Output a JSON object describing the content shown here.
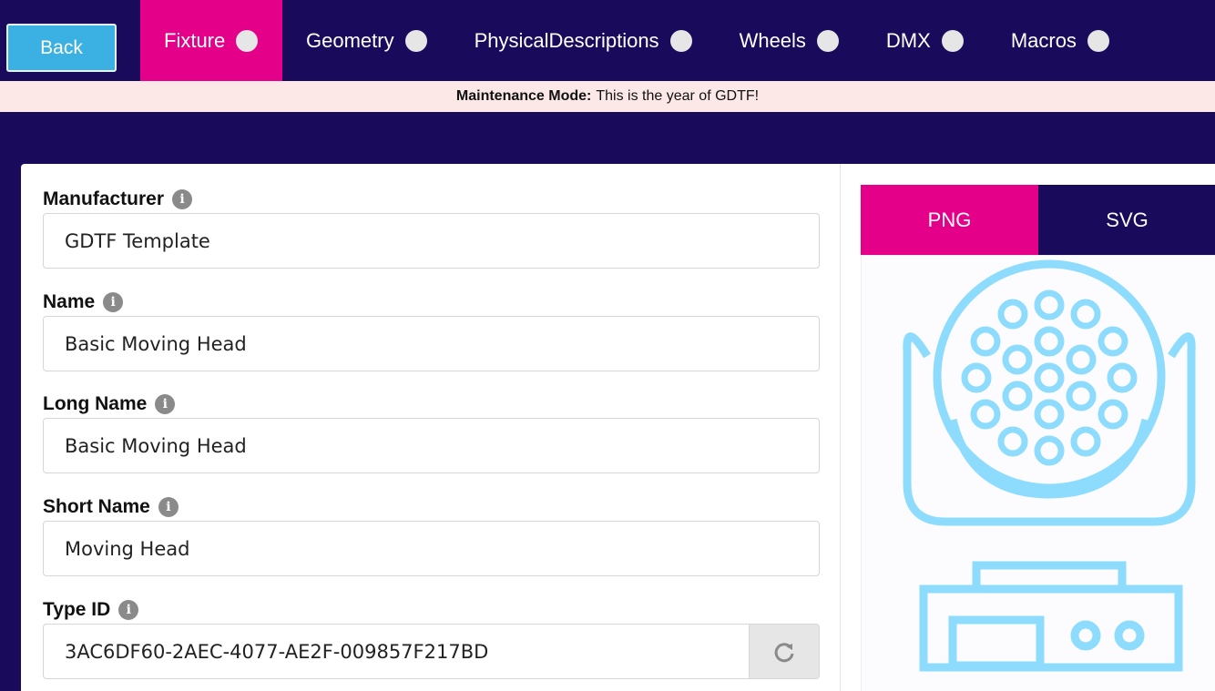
{
  "topbar": {
    "back_label": "Back",
    "tabs": [
      {
        "label": "Fixture",
        "active": true
      },
      {
        "label": "Geometry",
        "active": false
      },
      {
        "label": "PhysicalDescriptions",
        "active": false
      },
      {
        "label": "Wheels",
        "active": false
      },
      {
        "label": "DMX",
        "active": false
      },
      {
        "label": "Macros",
        "active": false
      }
    ]
  },
  "banner": {
    "title": "Maintenance Mode:",
    "message": "This is the year of GDTF!"
  },
  "form": {
    "fields": [
      {
        "label": "Manufacturer",
        "value": "GDTF Template"
      },
      {
        "label": "Name",
        "value": "Basic Moving Head"
      },
      {
        "label": "Long Name",
        "value": "Basic Moving Head"
      },
      {
        "label": "Short Name",
        "value": "Moving Head"
      },
      {
        "label": "Type ID",
        "value": "3AC6DF60-2AEC-4077-AE2F-009857F217BD"
      }
    ],
    "info_glyph": "i"
  },
  "preview": {
    "tabs": [
      {
        "label": "PNG",
        "active": true
      },
      {
        "label": "SVG",
        "active": false
      }
    ],
    "icon": "moving-head-fixture-icon"
  },
  "colors": {
    "background": "#1a0a5c",
    "accent": "#e5008a",
    "back_button": "#3bb0e2",
    "banner": "#fde8e8",
    "icon_stroke": "#8ddcfd"
  }
}
